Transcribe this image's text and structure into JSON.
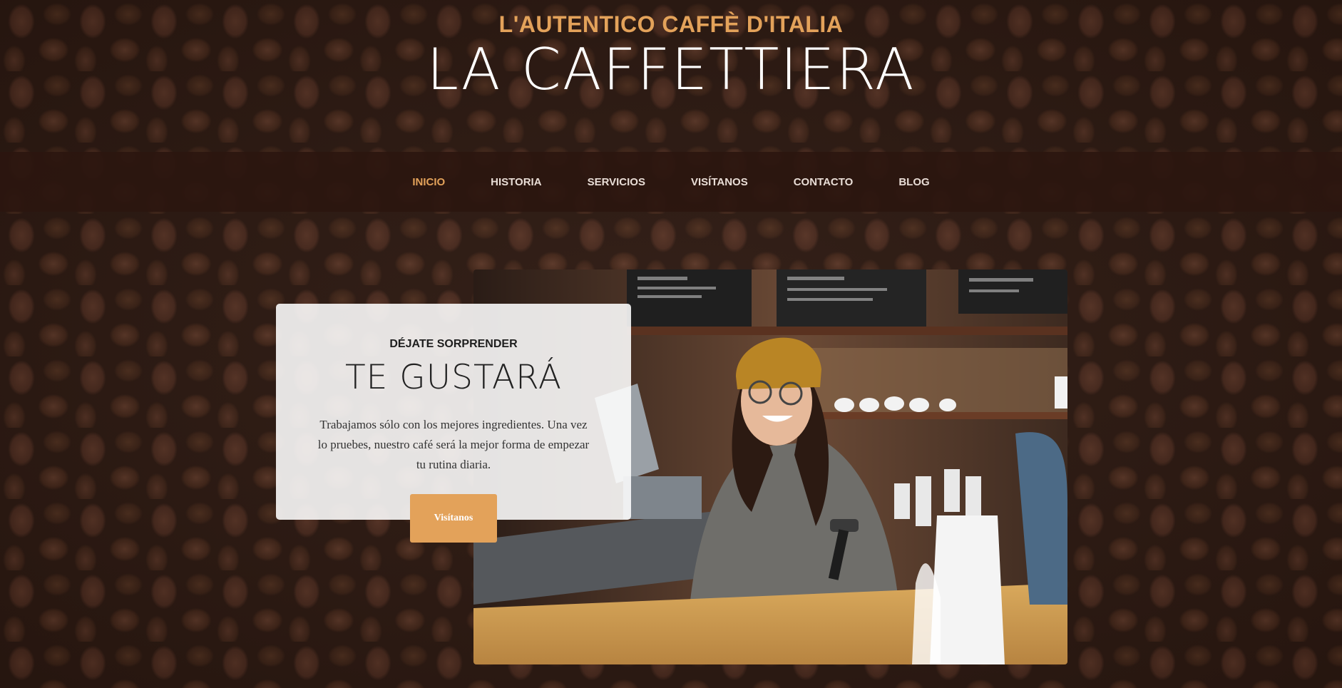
{
  "header": {
    "subtitle": "L'AUTENTICO CAFFÈ D'ITALIA",
    "title": "LA CAFFETTIERA"
  },
  "nav": {
    "items": [
      {
        "label": "INICIO",
        "active": true
      },
      {
        "label": "HISTORIA",
        "active": false
      },
      {
        "label": "SERVICIOS",
        "active": false
      },
      {
        "label": "VISÍTANOS",
        "active": false
      },
      {
        "label": "CONTACTO",
        "active": false
      },
      {
        "label": "BLOG",
        "active": false
      }
    ]
  },
  "intro": {
    "kicker": "DÉJATE SORPRENDER",
    "title": "TE GUSTARÁ",
    "text": "Trabajamos sólo con los mejores ingredientes. Una vez lo pruebes, nuestro café será la mejor forma de empezar tu rutina diaria.",
    "button_label": "Visítanos"
  },
  "colors": {
    "accent": "#e3a25a",
    "nav_background": "#2b160f",
    "page_background": "#3b2218"
  }
}
